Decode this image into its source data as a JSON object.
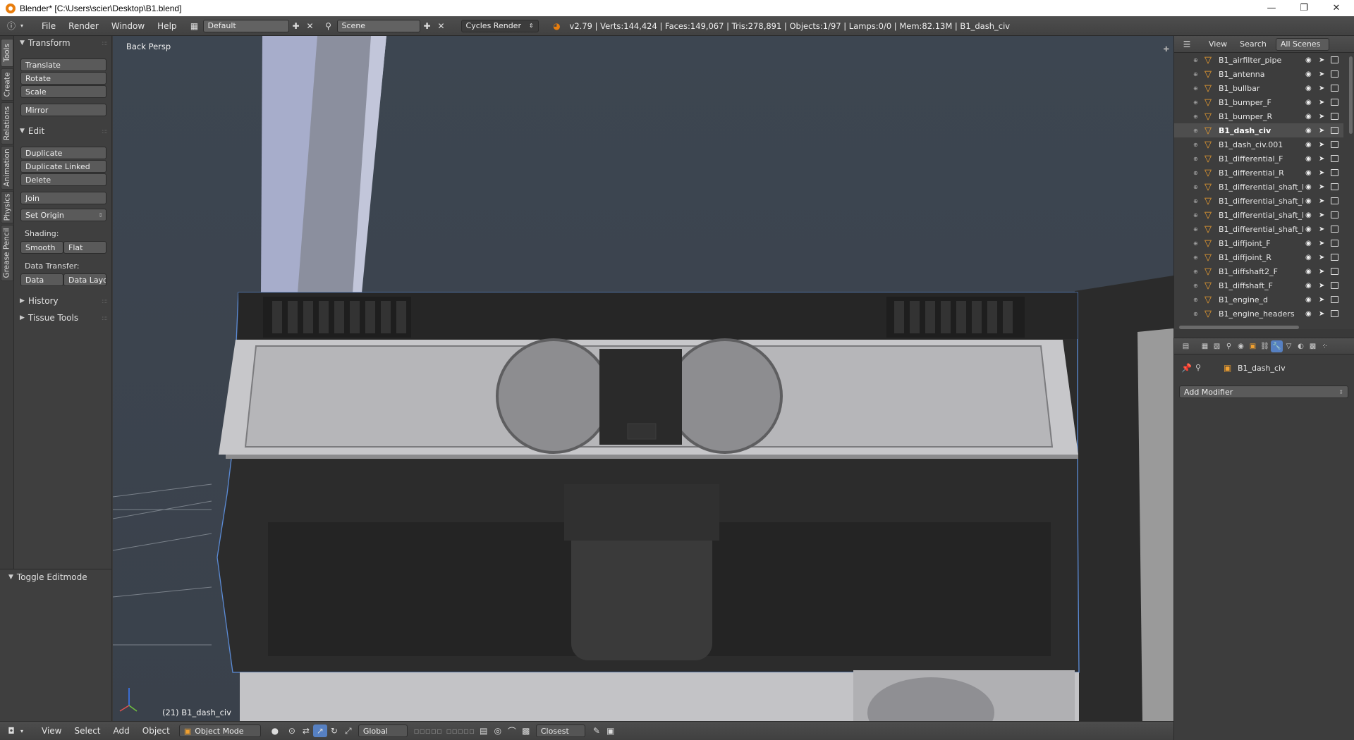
{
  "window": {
    "title": "Blender* [C:\\Users\\scier\\Desktop\\B1.blend]",
    "minimize_glyph": "—",
    "maximize_glyph": "❐",
    "close_glyph": "✕"
  },
  "info_header": {
    "menus": [
      "File",
      "Render",
      "Window",
      "Help"
    ],
    "layout": "Default",
    "scene": "Scene",
    "engine": "Cycles Render",
    "stats": "v2.79 | Verts:144,424 | Faces:149,067 | Tris:278,891 | Objects:1/97 | Lamps:0/0 | Mem:82.13M | B1_dash_civ"
  },
  "toolshelf_tabs": [
    "Tools",
    "Create",
    "Relations",
    "Animation",
    "Physics",
    "Grease Pencil"
  ],
  "tool_panel": {
    "transform": {
      "header": "Transform",
      "buttons": [
        "Translate",
        "Rotate",
        "Scale",
        "Mirror"
      ]
    },
    "edit": {
      "header": "Edit",
      "buttons": [
        "Duplicate",
        "Duplicate Linked",
        "Delete",
        "Join",
        "Set Origin"
      ]
    },
    "shading": {
      "label": "Shading:",
      "smooth": "Smooth",
      "flat": "Flat"
    },
    "data_transfer": {
      "label": "Data Transfer:",
      "data": "Data",
      "data_layout": "Data Layo"
    },
    "history": "History",
    "tissue_tools": "Tissue Tools"
  },
  "operator_panel": {
    "header": "Toggle Editmode"
  },
  "viewport": {
    "view_label": "Back Persp",
    "object_label": "(21) B1_dash_civ"
  },
  "bottom_header": {
    "menus": [
      "View",
      "Select",
      "Add",
      "Object"
    ],
    "mode": "Object Mode",
    "orientation": "Global",
    "snap_target": "Closest"
  },
  "outliner": {
    "menus": [
      "View",
      "Search"
    ],
    "display_mode": "All Scenes",
    "items": [
      {
        "name": "B1_airfilter_pipe",
        "active": false
      },
      {
        "name": "B1_antenna",
        "active": false
      },
      {
        "name": "B1_bullbar",
        "active": false
      },
      {
        "name": "B1_bumper_F",
        "active": false
      },
      {
        "name": "B1_bumper_R",
        "active": false
      },
      {
        "name": "B1_dash_civ",
        "active": true
      },
      {
        "name": "B1_dash_civ.001",
        "active": false
      },
      {
        "name": "B1_differential_F",
        "active": false
      },
      {
        "name": "B1_differential_R",
        "active": false
      },
      {
        "name": "B1_differential_shaft_Fl",
        "active": false
      },
      {
        "name": "B1_differential_shaft_Fl",
        "active": false
      },
      {
        "name": "B1_differential_shaft_Rl",
        "active": false
      },
      {
        "name": "B1_differential_shaft_Rl",
        "active": false
      },
      {
        "name": "B1_diffjoint_F",
        "active": false
      },
      {
        "name": "B1_diffjoint_R",
        "active": false
      },
      {
        "name": "B1_diffshaft2_F",
        "active": false
      },
      {
        "name": "B1_diffshaft_F",
        "active": false
      },
      {
        "name": "B1_engine_d",
        "active": false
      },
      {
        "name": "B1_engine_headers",
        "active": false
      }
    ]
  },
  "properties": {
    "object_name": "B1_dash_civ",
    "add_modifier": "Add Modifier"
  },
  "colors": {
    "panel_bg": "#3f3f3f",
    "button_bg": "#5a5a5a",
    "viewport_bg": "#3c4550",
    "selection_outline": "#5b8bd6",
    "mesh_icon": "#f0a030",
    "active_tab": "#5680c2"
  }
}
